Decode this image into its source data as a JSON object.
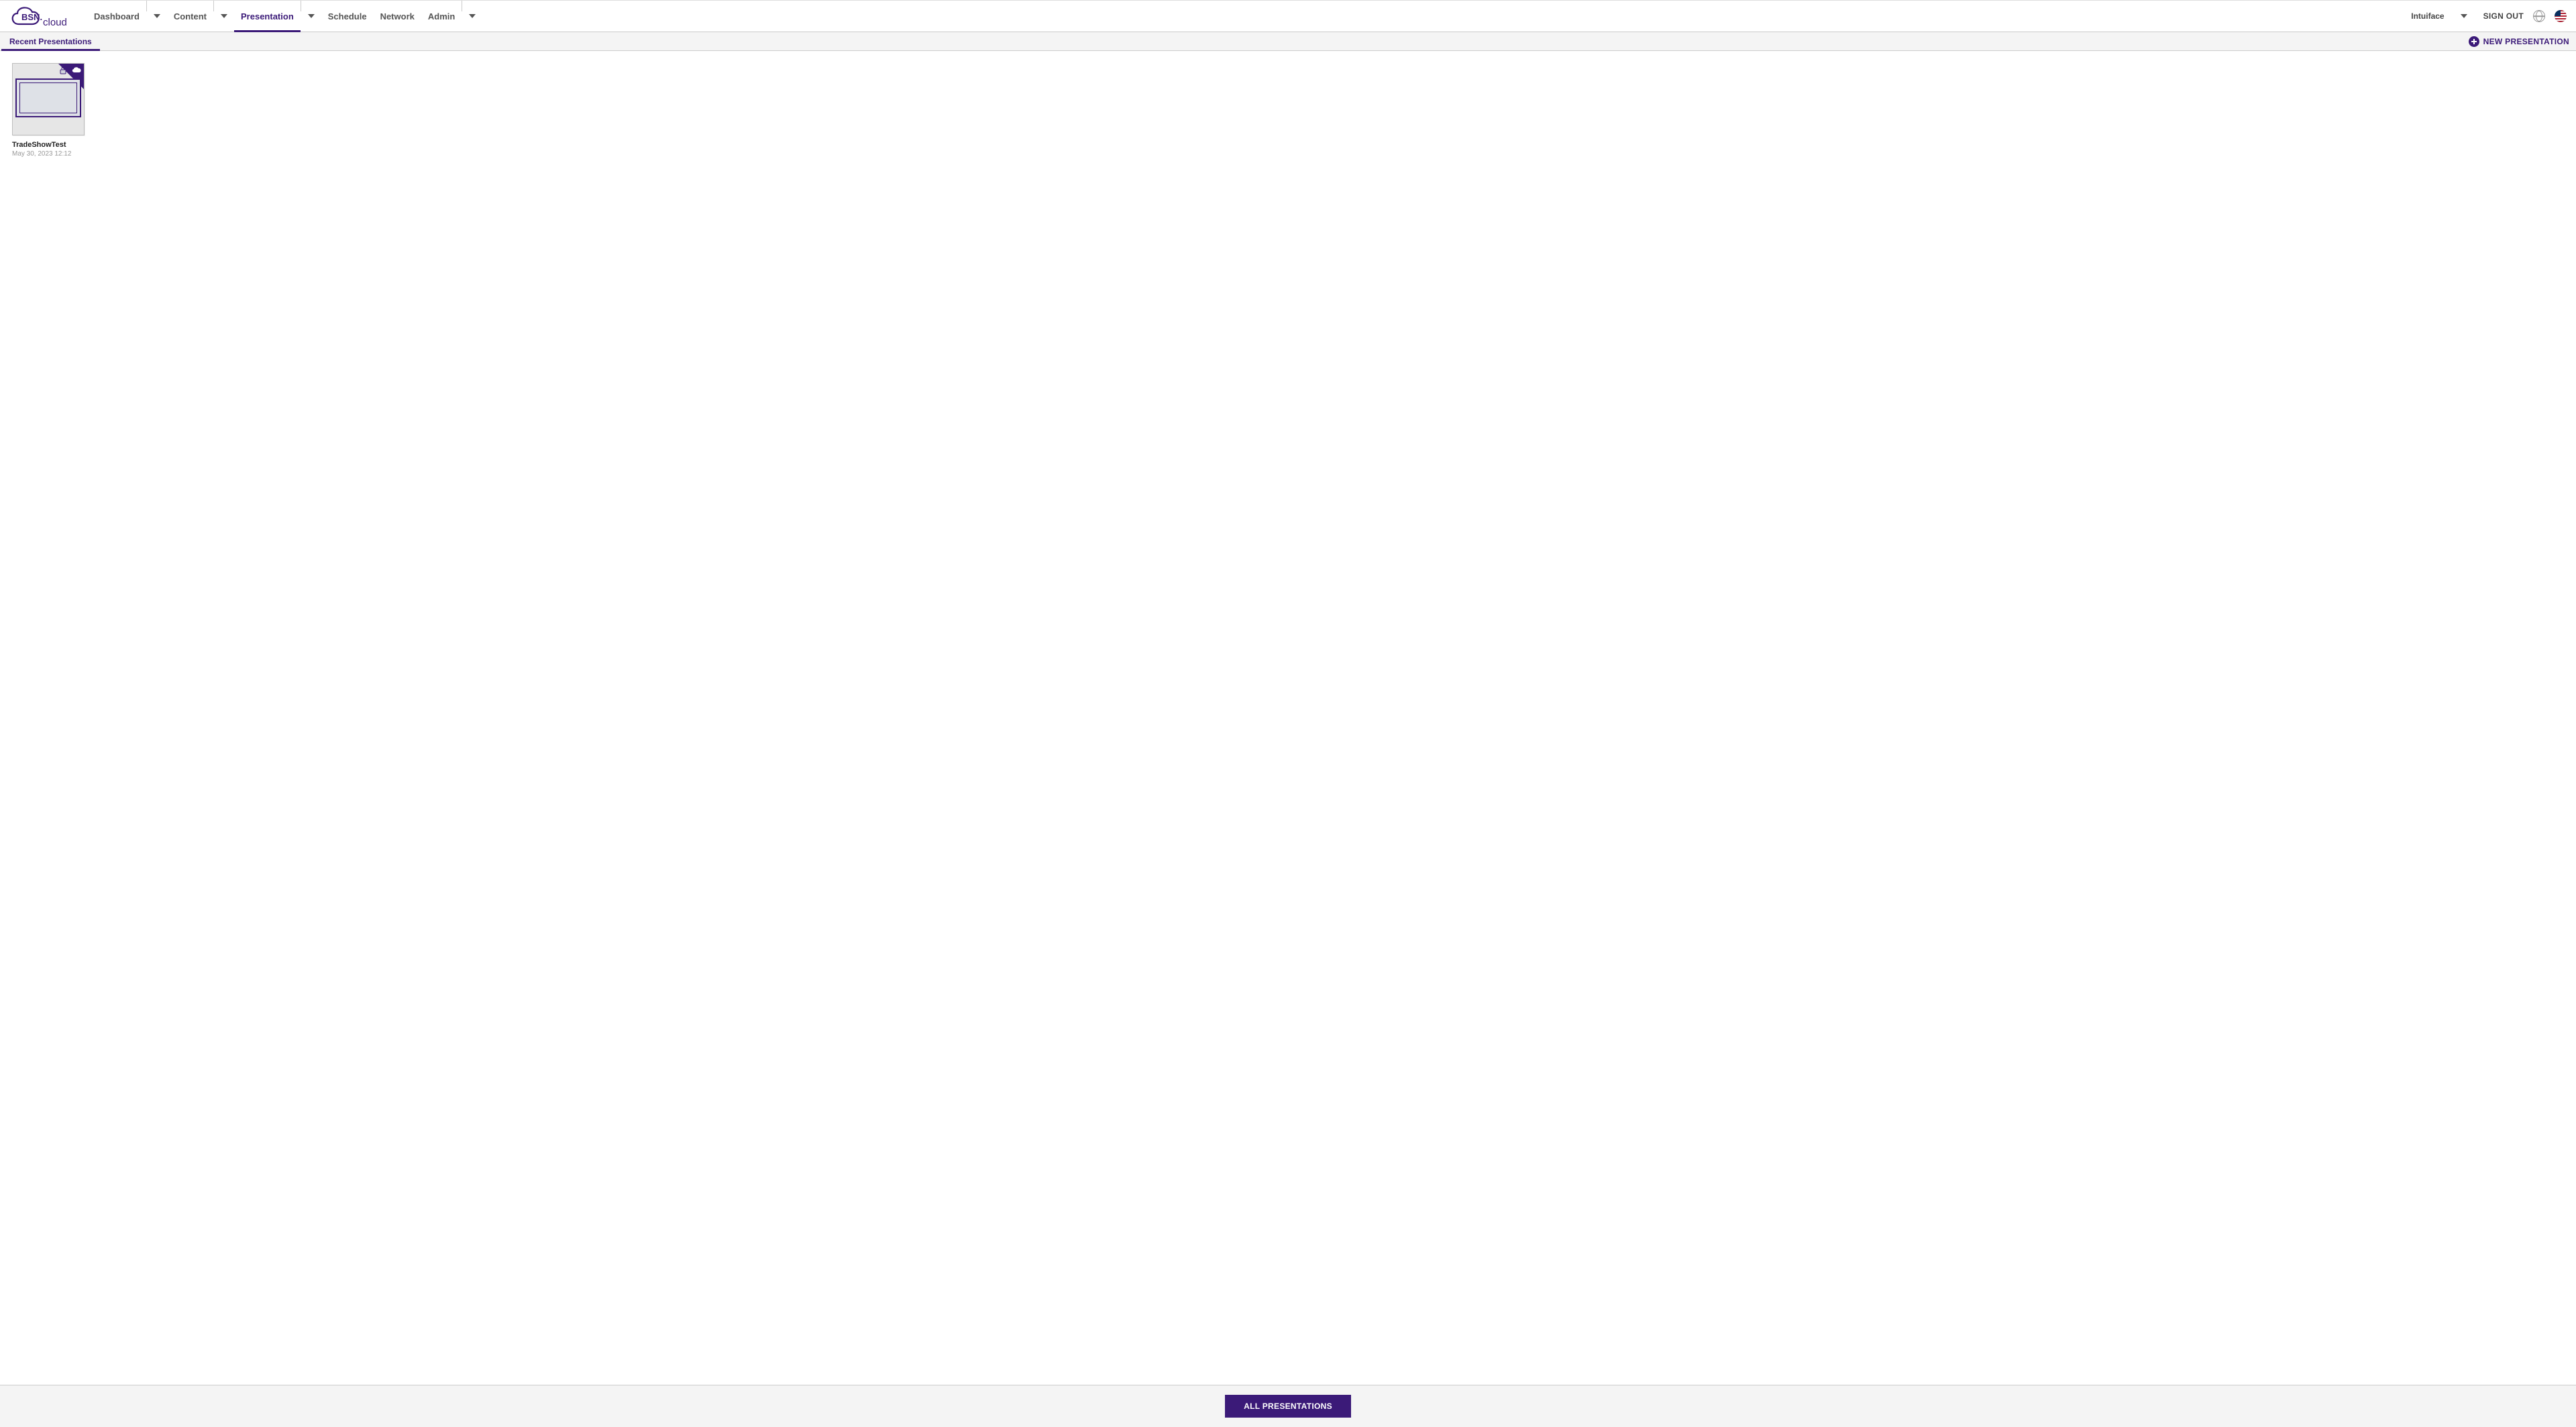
{
  "brand": {
    "name_bold": "BSN.",
    "name_light": "cloud"
  },
  "nav": {
    "items": [
      {
        "label": "Dashboard",
        "has_dropdown": true,
        "active": false
      },
      {
        "label": "Content",
        "has_dropdown": true,
        "active": false
      },
      {
        "label": "Presentation",
        "has_dropdown": true,
        "active": true
      },
      {
        "label": "Schedule",
        "has_dropdown": false,
        "active": false
      },
      {
        "label": "Network",
        "has_dropdown": false,
        "active": false
      },
      {
        "label": "Admin",
        "has_dropdown": true,
        "active": false
      }
    ]
  },
  "header_right": {
    "user": "Intuiface",
    "signout": "SIGN OUT",
    "region_icon": "globe-icon",
    "locale_flag": "us-flag"
  },
  "subheader": {
    "tab": "Recent Presentations",
    "new_button": "NEW PRESENTATION"
  },
  "presentations": [
    {
      "title": "TradeShowTest",
      "date": "May 30, 2023 12:12",
      "cloud": true,
      "locked": true
    }
  ],
  "footer": {
    "all_button": "ALL PRESENTATIONS"
  }
}
